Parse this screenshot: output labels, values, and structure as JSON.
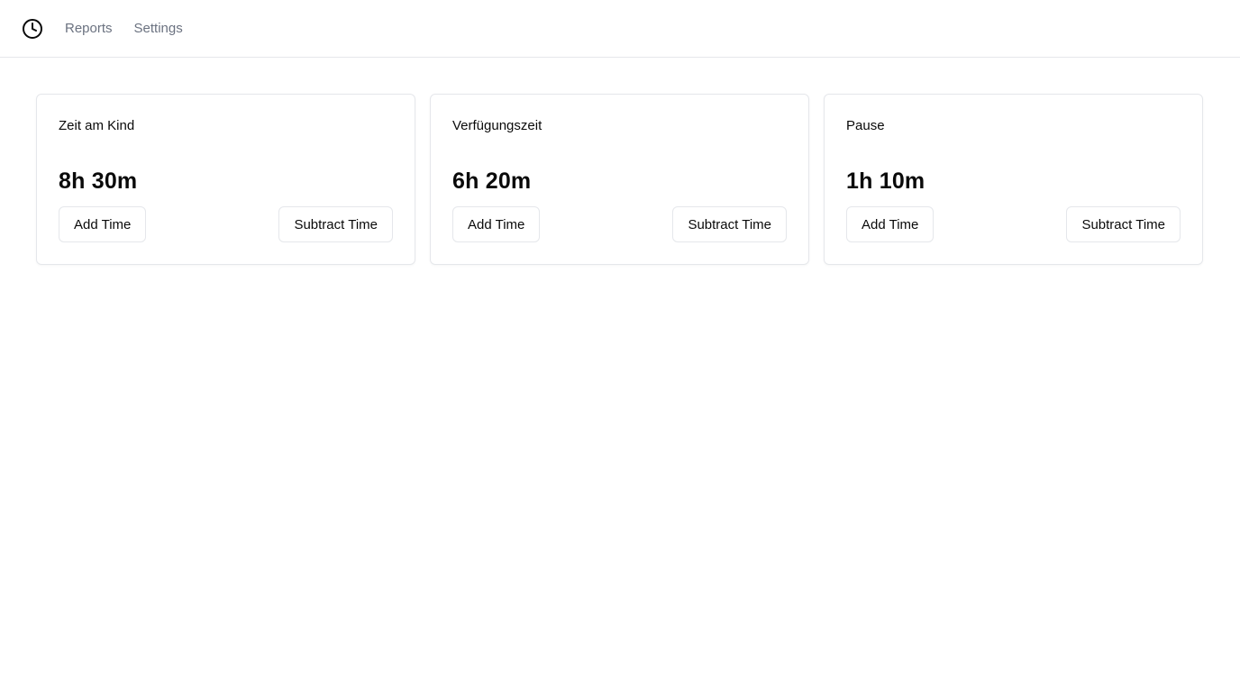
{
  "nav": {
    "logo_icon": "clock-icon",
    "links": [
      {
        "label": "Reports"
      },
      {
        "label": "Settings"
      }
    ]
  },
  "cards": [
    {
      "title": "Zeit am Kind",
      "value": "8h 30m",
      "add_label": "Add Time",
      "subtract_label": "Subtract Time"
    },
    {
      "title": "Verfügungszeit",
      "value": "6h 20m",
      "add_label": "Add Time",
      "subtract_label": "Subtract Time"
    },
    {
      "title": "Pause",
      "value": "1h 10m",
      "add_label": "Add Time",
      "subtract_label": "Subtract Time"
    }
  ],
  "colors": {
    "text": "#0a0a0a",
    "muted": "#6b7280",
    "border": "#e5e7eb",
    "background": "#ffffff"
  }
}
